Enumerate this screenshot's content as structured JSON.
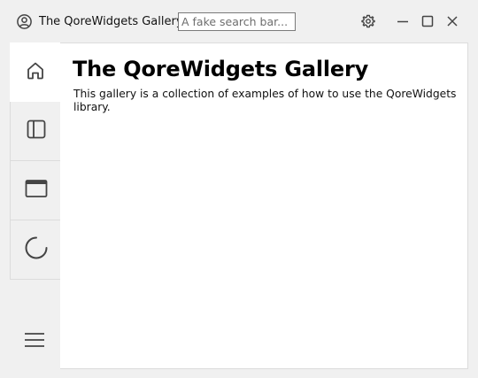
{
  "window": {
    "title": "The QoreWidgets Gallery"
  },
  "search": {
    "placeholder": "A fake search bar..."
  },
  "icons": {
    "app": "person-circle-icon",
    "settings": "gear-icon",
    "minimize": "minimize-icon",
    "maximize": "maximize-icon",
    "close": "close-icon",
    "menu": "hamburger-menu-icon"
  },
  "sidebar": {
    "items": [
      {
        "icon": "home-icon",
        "active": true
      },
      {
        "icon": "sidebar-panel-icon",
        "active": false
      },
      {
        "icon": "window-icon",
        "active": false
      },
      {
        "icon": "spinner-icon",
        "active": false
      }
    ]
  },
  "main": {
    "heading": "The QoreWidgets Gallery",
    "description": "This gallery is a collection of examples of how to use the QoreWidgets library."
  },
  "colors": {
    "background": "#f0f0f0",
    "content": "#ffffff",
    "icon": "#444444"
  }
}
